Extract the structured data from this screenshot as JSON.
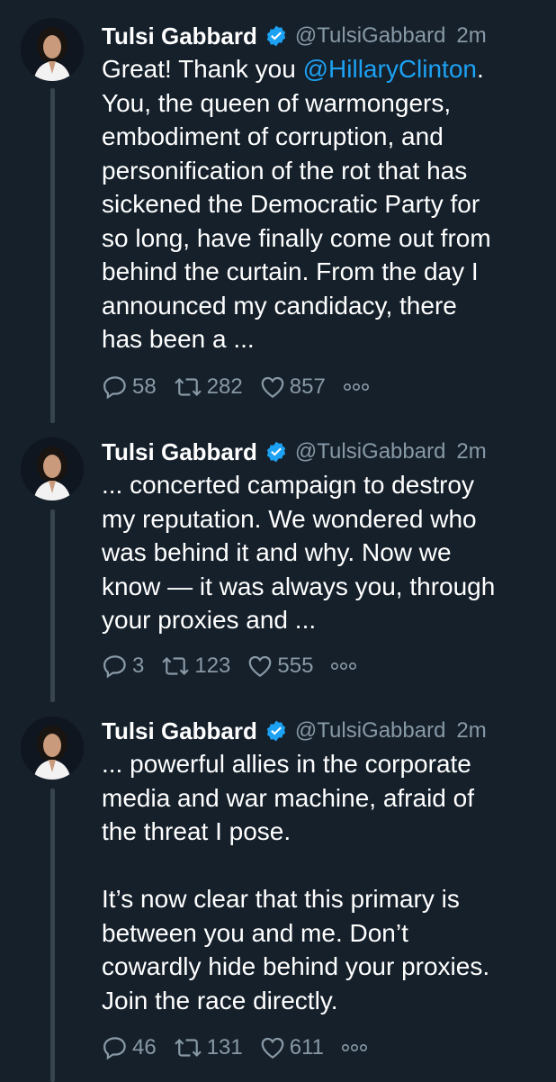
{
  "colors": {
    "background": "#15202b",
    "text": "#ffffff",
    "secondary": "#8899a6",
    "accent": "#1da1f2",
    "thread_line": "#38444d"
  },
  "tweets": [
    {
      "name": "Tulsi Gabbard",
      "handle": "@TulsiGabbard",
      "time": "2m",
      "text_before": "Great! Thank you ",
      "mention": "@HillaryClinton",
      "text_after": ".\nYou, the queen of warmongers,\nembodiment of corruption, and\npersonification of the rot that has\nsickened the Democratic Party for\nso long, have finally come out from\nbehind the curtain. From the day I\nannounced my candidacy, there\nhas been a ...",
      "replies": "58",
      "retweets": "282",
      "likes": "857"
    },
    {
      "name": "Tulsi Gabbard",
      "handle": "@TulsiGabbard",
      "time": "2m",
      "text": "... concerted campaign to destroy\nmy reputation. We wondered who\nwas behind it and why. Now we\nknow — it was always you, through\nyour proxies and ...",
      "replies": "3",
      "retweets": "123",
      "likes": "555"
    },
    {
      "name": "Tulsi Gabbard",
      "handle": "@TulsiGabbard",
      "time": "2m",
      "text": "... powerful allies in the corporate\nmedia and war machine, afraid of\nthe threat I pose.\n\nIt’s now clear that this primary is\nbetween you and me. Don’t\ncowardly hide behind your proxies.\nJoin the race directly.",
      "replies": "46",
      "retweets": "131",
      "likes": "611"
    }
  ],
  "icons": {
    "verified": "verified-badge-icon",
    "reply": "reply-icon",
    "retweet": "retweet-icon",
    "like": "heart-icon",
    "more": "more-dots-icon"
  }
}
